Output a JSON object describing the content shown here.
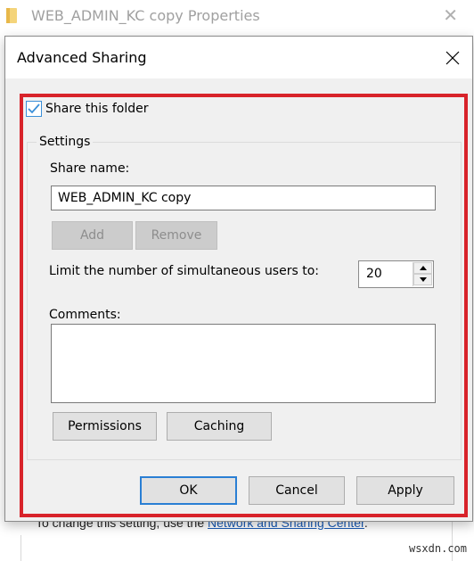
{
  "background_window": {
    "title": "WEB_ADMIN_KC copy Properties",
    "icon": "folder-icon",
    "close_icon": "close-icon",
    "body_text_prefix": "To change this setting, use the ",
    "body_link": "Network and Sharing Center",
    "body_text_suffix": "."
  },
  "dialog": {
    "title": "Advanced Sharing",
    "close_icon": "close-icon",
    "share_folder": {
      "label": "Share this folder",
      "checked": true
    },
    "settings": {
      "legend": "Settings",
      "share_name_label": "Share name:",
      "share_name_value": "WEB_ADMIN_KC copy",
      "add_label": "Add",
      "remove_label": "Remove",
      "limit_label": "Limit the number of simultaneous users to:",
      "limit_value": "20",
      "comments_label": "Comments:",
      "comments_value": "",
      "permissions_label": "Permissions",
      "caching_label": "Caching"
    },
    "buttons": {
      "ok": "OK",
      "cancel": "Cancel",
      "apply": "Apply"
    }
  },
  "annotation": {
    "highlight_color": "#d8232a"
  },
  "watermark": "wsxdn.com"
}
